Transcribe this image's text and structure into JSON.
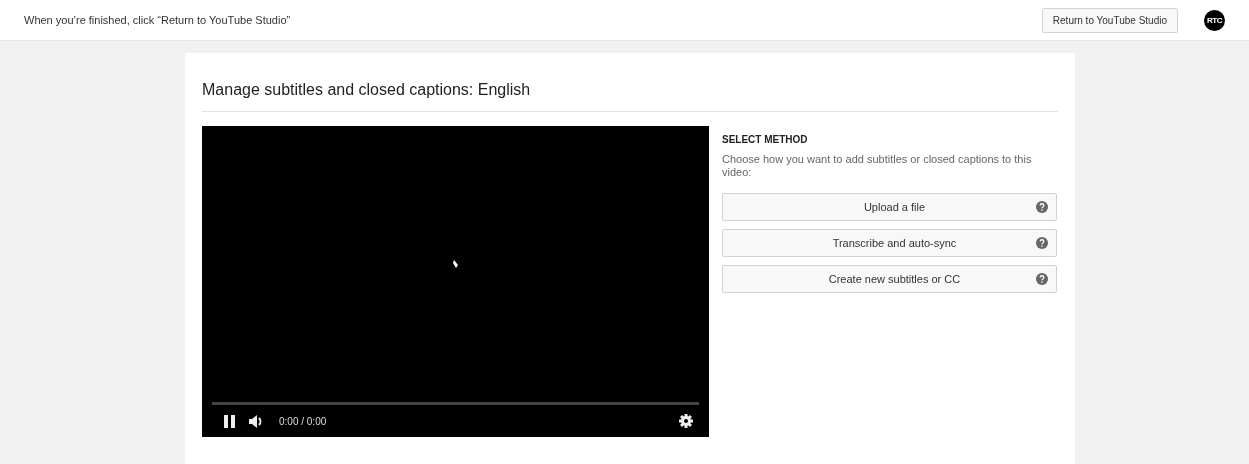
{
  "header": {
    "message": "When you’re finished, click “Return to YouTube Studio”",
    "return_button": "Return to YouTube Studio",
    "avatar": "RTC"
  },
  "card": {
    "title": "Manage subtitles and closed captions: English",
    "player": {
      "playing": true,
      "time": "0:00 / 0:00"
    },
    "method": {
      "heading": "SELECT METHOD",
      "description": "Choose how you want to add subtitles or closed captions to this video:",
      "options": [
        {
          "label": "Upload a file"
        },
        {
          "label": "Transcribe and auto-sync"
        },
        {
          "label": "Create new subtitles or CC"
        }
      ]
    }
  }
}
